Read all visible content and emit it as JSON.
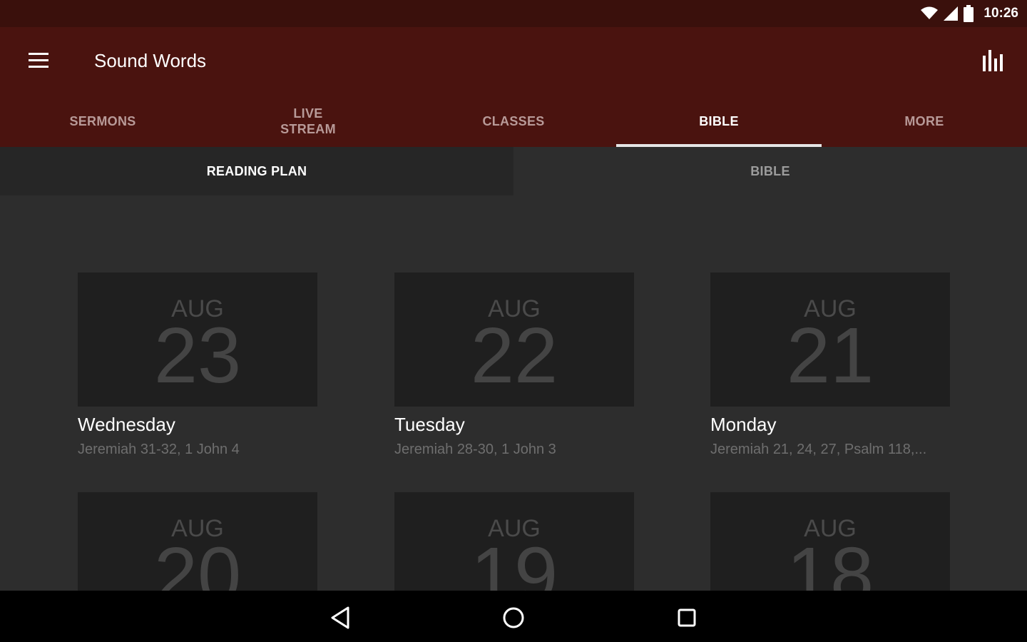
{
  "status_bar": {
    "time": "10:26"
  },
  "app_bar": {
    "title": "Sound Words"
  },
  "tabs": [
    {
      "label": "SERMONS",
      "active": false
    },
    {
      "label": "LIVE\nSTREAM",
      "active": false
    },
    {
      "label": "CLASSES",
      "active": false
    },
    {
      "label": "BIBLE",
      "active": true
    },
    {
      "label": "MORE",
      "active": false
    }
  ],
  "subtabs": [
    {
      "label": "READING PLAN",
      "active": true
    },
    {
      "label": "BIBLE",
      "active": false
    }
  ],
  "cards": [
    {
      "month": "AUG",
      "day": "23",
      "weekday": "Wednesday",
      "reading": "Jeremiah 31-32, 1 John 4"
    },
    {
      "month": "AUG",
      "day": "22",
      "weekday": "Tuesday",
      "reading": "Jeremiah 28-30, 1 John 3"
    },
    {
      "month": "AUG",
      "day": "21",
      "weekday": "Monday",
      "reading": "Jeremiah 21, 24, 27, Psalm 118,..."
    },
    {
      "month": "AUG",
      "day": "20",
      "weekday": "",
      "reading": ""
    },
    {
      "month": "AUG",
      "day": "19",
      "weekday": "",
      "reading": ""
    },
    {
      "month": "AUG",
      "day": "18",
      "weekday": "",
      "reading": ""
    }
  ],
  "icons": {
    "menu": "menu-icon",
    "stats": "bar-chart-icon",
    "wifi": "wifi-icon",
    "signal": "signal-icon",
    "battery": "battery-icon",
    "back": "back-icon",
    "home": "home-icon",
    "recents": "recents-icon"
  },
  "colors": {
    "app_bar": "#4a130f",
    "status_bar": "#3a100c",
    "background": "#2d2d2d",
    "card": "#1f1f1f"
  }
}
